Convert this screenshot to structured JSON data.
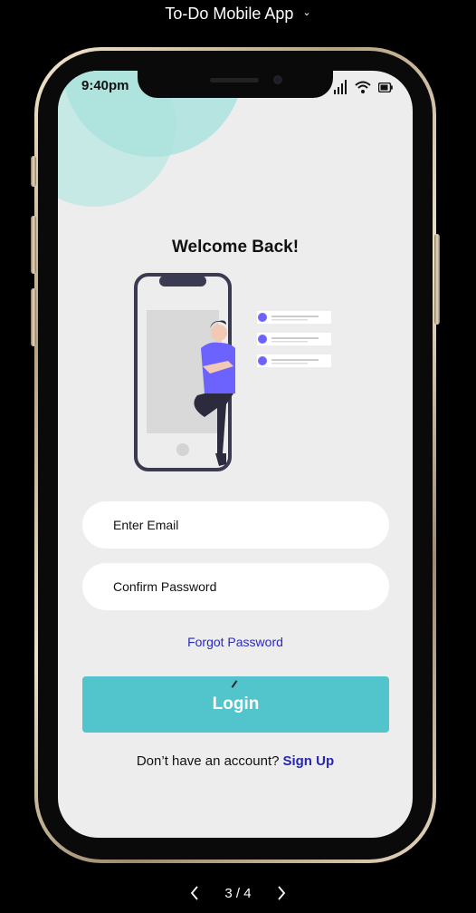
{
  "header": {
    "title": "To-Do Mobile App",
    "dropdown_icon": "chevron-down-icon"
  },
  "status_bar": {
    "time": "9:40pm",
    "icons": [
      "signal-icon",
      "wifi-icon",
      "battery-icon"
    ]
  },
  "screen": {
    "heading": "Welcome Back!",
    "email_placeholder": "Enter Email",
    "password_placeholder": "Confirm Password",
    "forgot_link": "Forgot Password",
    "login_label": "Login",
    "signup_prompt": "Don’t have an account?",
    "signup_link": "Sign Up"
  },
  "pager": {
    "current": "3",
    "total": "4",
    "label": "3 / 4"
  },
  "colors": {
    "accent": "#51c4cc",
    "link": "#2b2bb8",
    "background": "#ededed",
    "blob": "#a7e1dc",
    "figure_shirt": "#6c63ff"
  }
}
